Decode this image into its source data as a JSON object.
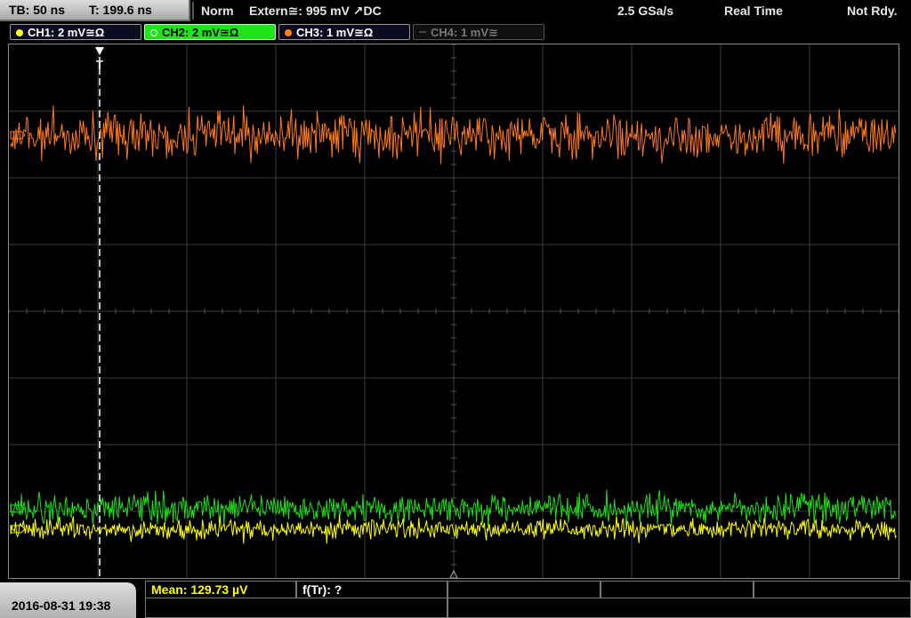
{
  "timebase": {
    "tb": "TB: 50 ns",
    "t": "T: 199.6 ns"
  },
  "status": {
    "mode": "Norm",
    "trigger": "Extern≅: 995 mV ↗DC",
    "sample_rate": "2.5 GSa/s",
    "acquisition": "Real Time",
    "ready": "Not Rdy."
  },
  "channels": [
    {
      "label": "CH1: 2 mV≅Ω",
      "color": "#ffff20",
      "state": "on"
    },
    {
      "label": "CH2: 2 mV≅Ω",
      "color": "#22e01e",
      "state": "active"
    },
    {
      "label": "CH3: 1 mV≅Ω",
      "color": "#ff7f1e",
      "state": "on"
    },
    {
      "label": "CH4: 1 mV≅",
      "color": "#666666",
      "state": "off"
    }
  ],
  "trigger_marker": "T",
  "measurements": {
    "mean": "Mean: 129.73 µV",
    "rise": "f(Tr): ?"
  },
  "datetime": "2016-08-31 19:38",
  "colors": {
    "grid": "#3a3a3a",
    "ch1_trace": "#ffff00",
    "ch2_trace": "#1ee01a",
    "ch3_trace": "#ff7a1a",
    "mean_text": "#ffff00"
  }
}
